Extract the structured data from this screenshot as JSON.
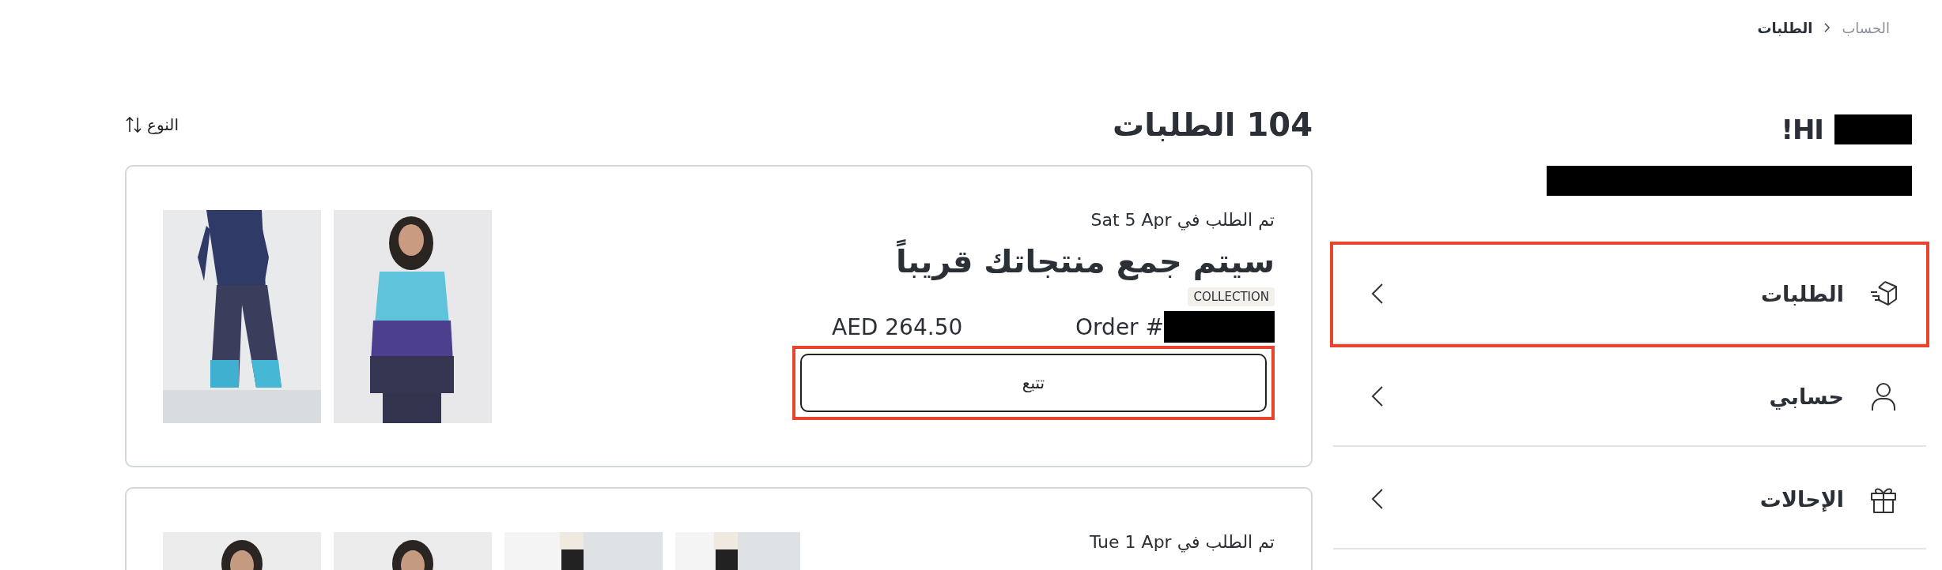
{
  "breadcrumb": [
    {
      "label": "الحساب",
      "current": false
    },
    {
      "label": "الطلبات",
      "current": true
    }
  ],
  "greeting": {
    "text": "HI!",
    "name_redacted": true,
    "email_redacted": true
  },
  "menu": [
    {
      "label": "الطلبات",
      "kind": "orders",
      "highlighted": true
    },
    {
      "label": "حسابي",
      "kind": "account",
      "highlighted": false
    },
    {
      "label": "الإحالات",
      "kind": "referrals",
      "highlighted": false
    }
  ],
  "orders_header": {
    "title": "104 الطلبات",
    "sort_label": "النوع"
  },
  "orders": [
    {
      "date": "تم الطلب في Sat 5 Apr",
      "status": "سيتم جمع منتجاتك قريباً",
      "tag": "COLLECTION",
      "total": "AED 264.50",
      "order_label": "Order #",
      "number_redacted": true,
      "action": "تتبع",
      "action_highlighted": true
    },
    {
      "date": "تم الطلب في Tue 1 Apr"
    }
  ]
}
